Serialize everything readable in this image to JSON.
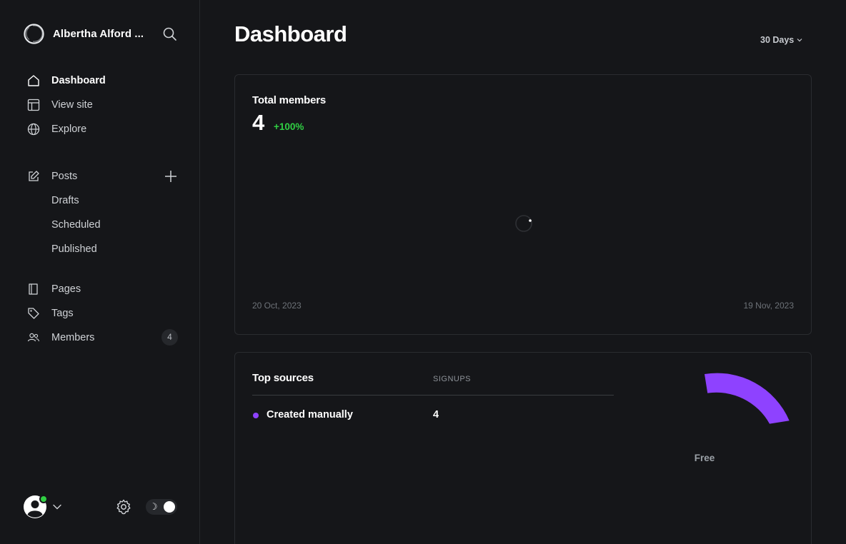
{
  "sidebar": {
    "site_name": "Albertha Alford ...",
    "nav": {
      "dashboard": "Dashboard",
      "view_site": "View site",
      "explore": "Explore",
      "posts": "Posts",
      "drafts": "Drafts",
      "scheduled": "Scheduled",
      "published": "Published",
      "pages": "Pages",
      "tags": "Tags",
      "members": "Members",
      "members_count": "4"
    },
    "footer": {
      "user_online": true,
      "theme_toggle_moon": "☽"
    }
  },
  "main": {
    "title": "Dashboard",
    "range_label": "30 Days",
    "members_card": {
      "title": "Total members",
      "value": "4",
      "delta": "+100%",
      "date_start": "20 Oct, 2023",
      "date_end": "19 Nov, 2023"
    },
    "sources_card": {
      "title": "Top sources",
      "column_header": "SIGNUPS",
      "rows": [
        {
          "name": "Created manually",
          "value": "4",
          "color": "#8e42ff"
        }
      ],
      "donut_label": "Free"
    }
  },
  "colors": {
    "accent_purple": "#8e42ff",
    "positive_green": "#30cf43",
    "background": "#151619"
  }
}
